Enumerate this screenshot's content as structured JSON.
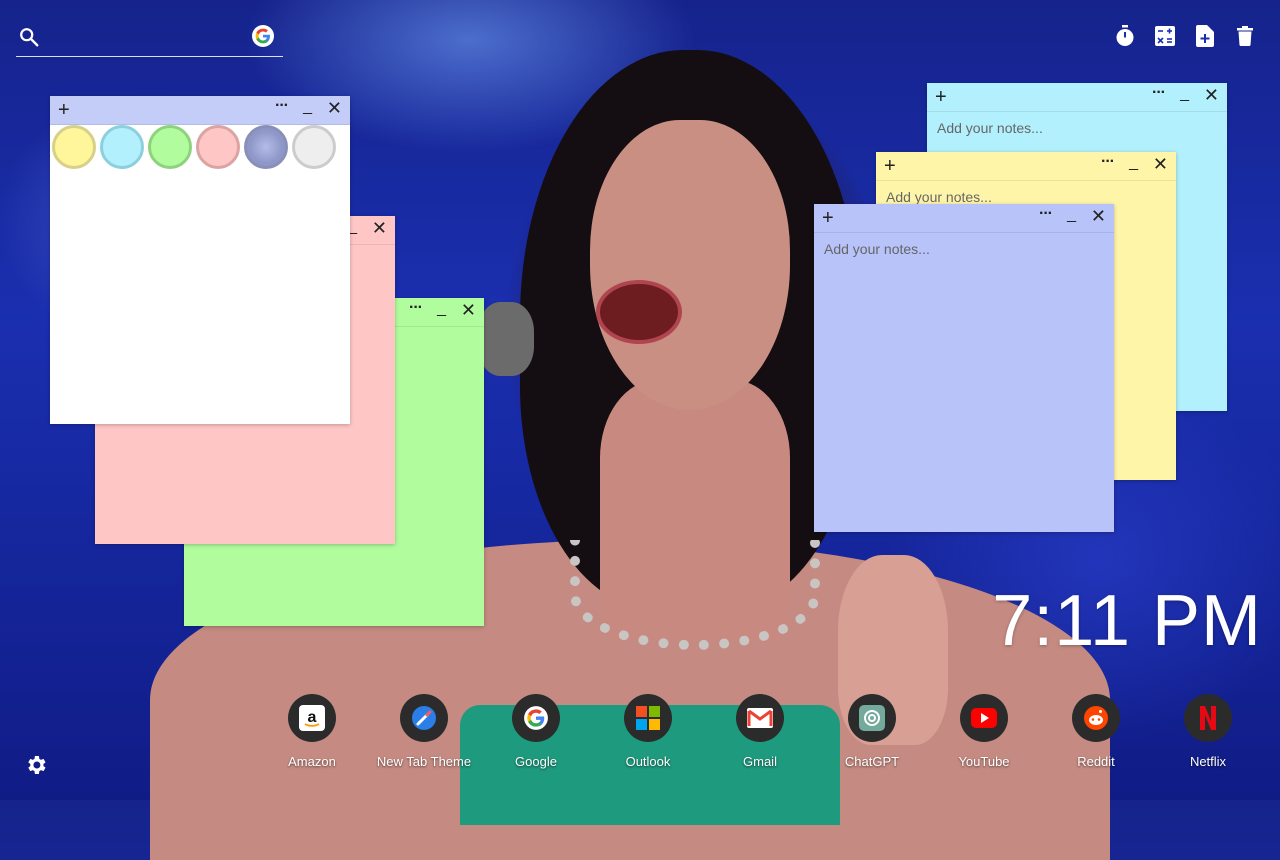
{
  "search": {
    "placeholder": ""
  },
  "toolbar": {
    "icons": [
      "timer-icon",
      "calculator-icon",
      "new-note-icon",
      "trash-icon"
    ]
  },
  "notes": {
    "placeholder": "Add your notes...",
    "colors": {
      "white": "#ffffff",
      "pink": "#ffc6c6",
      "green": "#b1fd9d",
      "cyan": "#b2f0fd",
      "yellow": "#fff5a9",
      "blue": "#b7c3f9"
    },
    "palette": [
      "yellow",
      "cyan",
      "green",
      "pink",
      "slate",
      "gray"
    ]
  },
  "clock": {
    "time": "7:11 PM"
  },
  "dock": {
    "apps": [
      {
        "label": "Amazon",
        "icon": "amazon-icon"
      },
      {
        "label": "New Tab Theme",
        "icon": "new-tab-theme-icon"
      },
      {
        "label": "Google",
        "icon": "google-icon"
      },
      {
        "label": "Outlook",
        "icon": "outlook-icon"
      },
      {
        "label": "Gmail",
        "icon": "gmail-icon"
      },
      {
        "label": "ChatGPT",
        "icon": "chatgpt-icon"
      },
      {
        "label": "YouTube",
        "icon": "youtube-icon"
      },
      {
        "label": "Reddit",
        "icon": "reddit-icon"
      },
      {
        "label": "Netflix",
        "icon": "netflix-icon"
      }
    ]
  },
  "settings": {
    "icon": "gear-icon"
  }
}
